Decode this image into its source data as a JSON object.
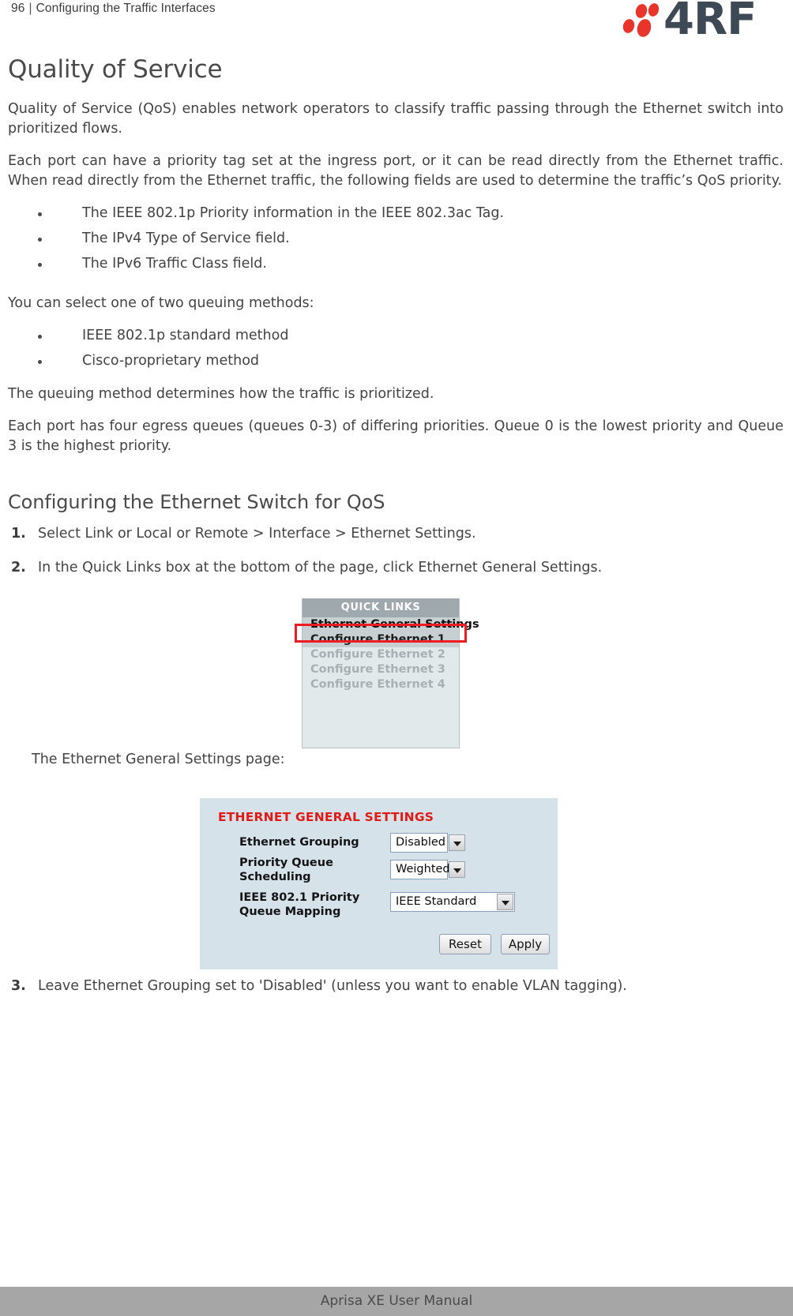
{
  "header": {
    "page_number": "96",
    "separator": "|",
    "chapter": "Configuring the Traffic Interfaces",
    "logo_text": "4RF",
    "logo_dot_color": "#e8342a",
    "logo_text_color": "#3d4a55"
  },
  "section": {
    "title": "Quality of Service",
    "paragraph_1": "Quality of Service (QoS) enables network operators to classify traffic passing through the Ethernet switch into prioritized flows.",
    "paragraph_2": "Each port can have a priority tag set at the ingress port, or it can be read directly from the Ethernet traffic. When read directly from the Ethernet traffic, the following fields are used to determine the traffic’s QoS priority.",
    "bullets_1": [
      "The IEEE 802.1p Priority information in the IEEE 802.3ac Tag.",
      "The IPv4 Type of Service field.",
      "The IPv6 Traffic Class field."
    ],
    "paragraph_3": "You can select one of two queuing methods:",
    "bullets_2": [
      "IEEE 802.1p standard method",
      "Cisco-proprietary method"
    ],
    "paragraph_4": "The queuing method determines how the traffic is prioritized.",
    "paragraph_5": "Each port has four egress queues (queues 0-3) of differing priorities. Queue 0 is the lowest priority and Queue 3 is the highest priority."
  },
  "subsection": {
    "title": "Configuring the Ethernet Switch for QoS",
    "steps": [
      {
        "num": "1.",
        "text": "Select Link or Local or Remote > Interface > Ethernet Settings."
      },
      {
        "num": "2.",
        "text": "In the Quick Links box at the bottom of the page, click Ethernet General Settings."
      },
      {
        "num": "3.",
        "text": "Leave Ethernet Grouping set to 'Disabled' (unless you want to enable VLAN tagging)."
      }
    ],
    "caption_egs": "The Ethernet General Settings page:"
  },
  "quick_links_screenshot": {
    "header_title": "QUICK LINKS",
    "header_bg": "#9fa8ac",
    "body_bg": "#e2e9ea",
    "highlight_color": "#ee1c22",
    "items": [
      {
        "label": "Ethernet General Settings",
        "state": "active"
      },
      {
        "label": "Configure Ethernet 1",
        "state": "enabled"
      },
      {
        "label": "Configure Ethernet 2",
        "state": "disabled"
      },
      {
        "label": "Configure Ethernet 3",
        "state": "disabled"
      },
      {
        "label": "Configure Ethernet 4",
        "state": "disabled"
      }
    ]
  },
  "ethernet_general_settings_screenshot": {
    "panel_title": "ETHERNET GENERAL SETTINGS",
    "panel_title_color": "#e01a15",
    "panel_bg": "#d6e2ea",
    "fields": [
      {
        "label_line1": "Ethernet Grouping",
        "label_line2": "",
        "value": "Disabled"
      },
      {
        "label_line1": "Priority Queue",
        "label_line2": "Scheduling",
        "value": "Weighted"
      },
      {
        "label_line1": "IEEE 802.1 Priority",
        "label_line2": "Queue Mapping",
        "value": "IEEE Standard"
      }
    ],
    "buttons": {
      "reset_label": "Reset",
      "apply_label": "Apply"
    }
  },
  "footer": {
    "text": "Aprisa XE User Manual",
    "bg": "#a6a6a6"
  }
}
